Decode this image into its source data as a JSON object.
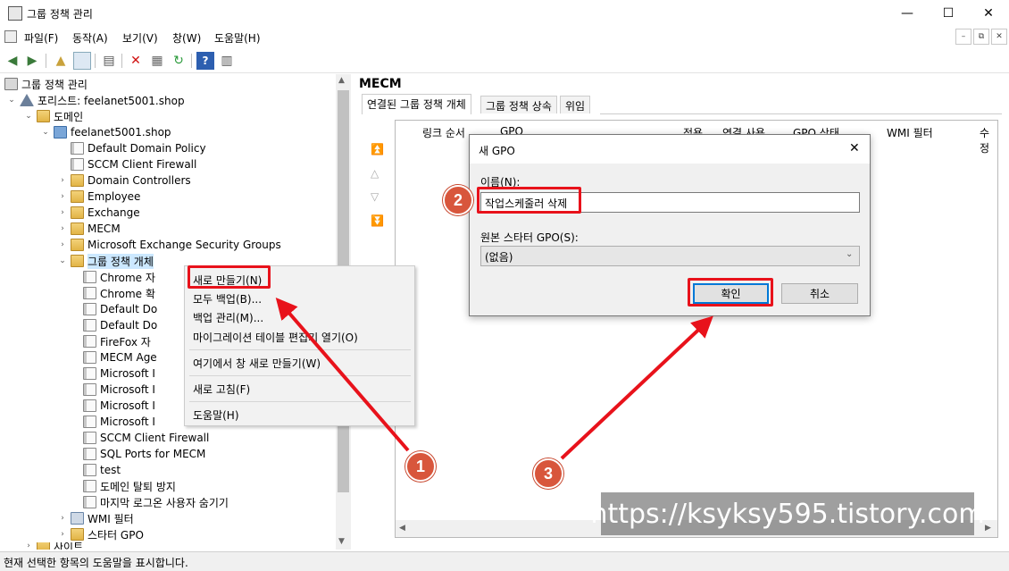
{
  "window": {
    "title": "그룹 정책 관리",
    "min": "—",
    "max": "☐",
    "close": "✕"
  },
  "menu": {
    "items": [
      "파일(F)",
      "동작(A)",
      "보기(V)",
      "창(W)",
      "도움말(H)"
    ],
    "mdi": [
      "–",
      "⧉",
      "✕"
    ]
  },
  "tree": {
    "root": "그룹 정책 관리",
    "forest": "포리스트: feelanet5001.shop",
    "domains": "도메인",
    "domain": "feelanet5001.shop",
    "children": [
      "Default Domain Policy",
      "SCCM Client Firewall",
      "Domain Controllers",
      "Employee",
      "Exchange",
      "MECM",
      "Microsoft Exchange Security Groups"
    ],
    "gpo_container": "그룹 정책 개체",
    "gpo_items": [
      "Chrome 자",
      "Chrome 확",
      "Default Do",
      "Default Do",
      "FireFox 자",
      "MECM Age",
      "Microsoft I",
      "Microsoft I",
      "Microsoft I",
      "Microsoft I",
      "SCCM Client Firewall",
      "SQL Ports for MECM",
      "test",
      "도메인 탈퇴 방지",
      "마지막 로그온 사용자 숨기기"
    ],
    "wmi": "WMI 필터",
    "starter": "스타터 GPO",
    "sites": "사이트"
  },
  "right": {
    "title": "MECM",
    "tabs": [
      "연결된 그룹 정책 개체",
      "그룹 정책 상속",
      "위임"
    ],
    "columns": [
      "링크 순서",
      "GPO",
      "적용",
      "연결 사용",
      "GPO 상태",
      "WMI 필터",
      "수정"
    ]
  },
  "context_menu": {
    "items": [
      "새로 만들기(N)",
      "모두 백업(B)...",
      "백업 관리(M)...",
      "마이그레이션 테이블 편집기 열기(O)",
      "여기에서 창 새로 만들기(W)",
      "새로 고침(F)",
      "도움말(H)"
    ]
  },
  "dialog": {
    "title": "새 GPO",
    "name_label": "이름(N):",
    "name_value": "작업스케줄러 삭제",
    "source_label": "원본 스타터 GPO(S):",
    "source_value": "(없음)",
    "ok": "확인",
    "cancel": "취소"
  },
  "status": "현재 선택한 항목의 도움말을 표시합니다.",
  "annotations": {
    "badges": [
      "1",
      "2",
      "3"
    ],
    "watermark": "https://ksyksy595.tistory.com",
    "color": "#e8121b"
  }
}
